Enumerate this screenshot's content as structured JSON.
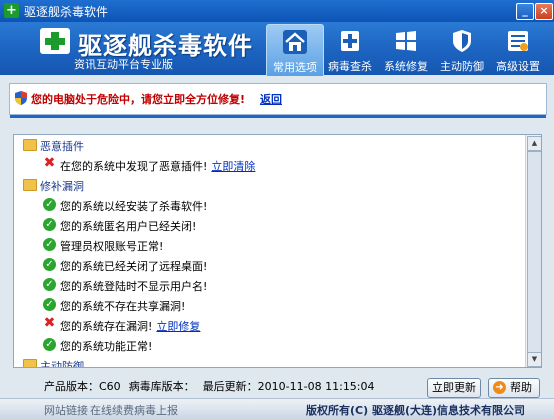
{
  "window": {
    "title": "驱逐舰杀毒软件",
    "min_glyph": "_",
    "close_glyph": "×",
    "app_glyph": "+"
  },
  "header": {
    "brand": "驱逐舰杀毒软件",
    "subtitle": "资讯互动平台专业版"
  },
  "nav": [
    {
      "label": "常用选项",
      "icon": "home-icon",
      "active": true
    },
    {
      "label": "病毒查杀",
      "icon": "medkit-icon",
      "active": false
    },
    {
      "label": "系统修复",
      "icon": "windows-icon",
      "active": false
    },
    {
      "label": "主动防御",
      "icon": "shield-icon",
      "active": false
    },
    {
      "label": "高级设置",
      "icon": "settings-icon",
      "active": false
    }
  ],
  "alert": {
    "text": "您的电脑处于危险中，请您立即全方位修复!",
    "link": "返回"
  },
  "list": {
    "categories": {
      "malware": "恶意插件",
      "vuln": "修补漏洞",
      "defense": "主动防御"
    },
    "malware_item": {
      "text": "在您的系统中发现了恶意插件!",
      "link": "立即清除"
    },
    "vuln_items": [
      {
        "status": "ok",
        "text": "您的系统以经安装了杀毒软件!"
      },
      {
        "status": "ok",
        "text": "您的系统匿名用户已经关闭!"
      },
      {
        "status": "ok",
        "text": "管理员权限账号正常!"
      },
      {
        "status": "ok",
        "text": "您的系统已经关闭了远程桌面!"
      },
      {
        "status": "ok",
        "text": "您的系统登陆时不显示用户名!"
      },
      {
        "status": "ok",
        "text": "您的系统不存在共享漏洞!"
      },
      {
        "status": "warn",
        "text": "您的系统存在漏洞!",
        "link": "立即修复"
      },
      {
        "status": "ok",
        "text": "您的系统功能正常!"
      }
    ]
  },
  "status": {
    "product_version": "产品版本：C60",
    "db_version": "病毒库版本：",
    "last_update": "最后更新：2010-11-08 11:15:04"
  },
  "buttons": {
    "update": "立即更新",
    "help": "帮助"
  },
  "footer": {
    "links": [
      "网站链接",
      "在线续费",
      "病毒上报"
    ],
    "copyright": "版权所有(C)  驱逐舰(大连)信息技术有限公司"
  },
  "colors": {
    "alert": "#c00000",
    "link": "#0030c0",
    "ok": "#2aa52e",
    "error": "#e02020",
    "brand_blue": "#1c63c0"
  }
}
